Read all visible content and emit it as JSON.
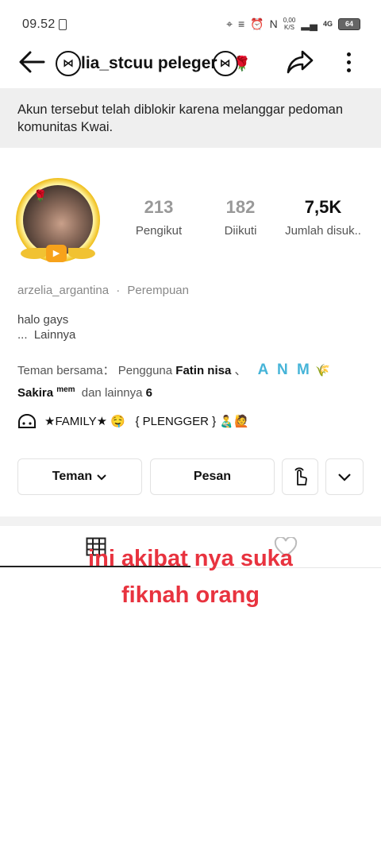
{
  "status_bar": {
    "time": "09.52",
    "net_speed_value": "0,00",
    "net_speed_unit": "K/S",
    "network": "4G",
    "battery": "64"
  },
  "header": {
    "title": "lia_stcuu peleger"
  },
  "banner": {
    "text": "Akun tersebut telah diblokir karena melanggar pedoman komunitas Kwai."
  },
  "stats": {
    "followers_count": "213",
    "followers_label": "Pengikut",
    "following_count": "182",
    "following_label": "Diikuti",
    "likes_count": "7,5K",
    "likes_label": "Jumlah disuk.."
  },
  "profile": {
    "username": "arzelia_argantina",
    "separator": "·",
    "gender": "Perempuan",
    "bio": "halo gays",
    "more_label": "...  Lainnya"
  },
  "mutual": {
    "prefix": "Teman bersama： Pengguna",
    "name1": "Fatin nisa",
    "sep": "、",
    "name2": "A N M",
    "name3": "Sakira",
    "name3_sup": "mem",
    "suffix": "dan lainnya",
    "count": "6"
  },
  "group": {
    "name": "★FAMILY★ 🤤   { PLENGGER } 👨‍🍼🙋"
  },
  "actions": {
    "friend_label": "Teman",
    "message_label": "Pesan"
  },
  "overlay": {
    "line1": "ini akibat nya suka",
    "line2": "fiknah orang"
  },
  "colors": {
    "accent_red": "#e8333f",
    "anm_blue": "#46b4d8",
    "banner_bg": "#efefef"
  },
  "icons": [
    "back-arrow-icon",
    "share-icon",
    "more-vertical-icon",
    "group-icon",
    "chevron-down-icon",
    "poke-hand-icon",
    "grid-icon",
    "heart-icon"
  ]
}
